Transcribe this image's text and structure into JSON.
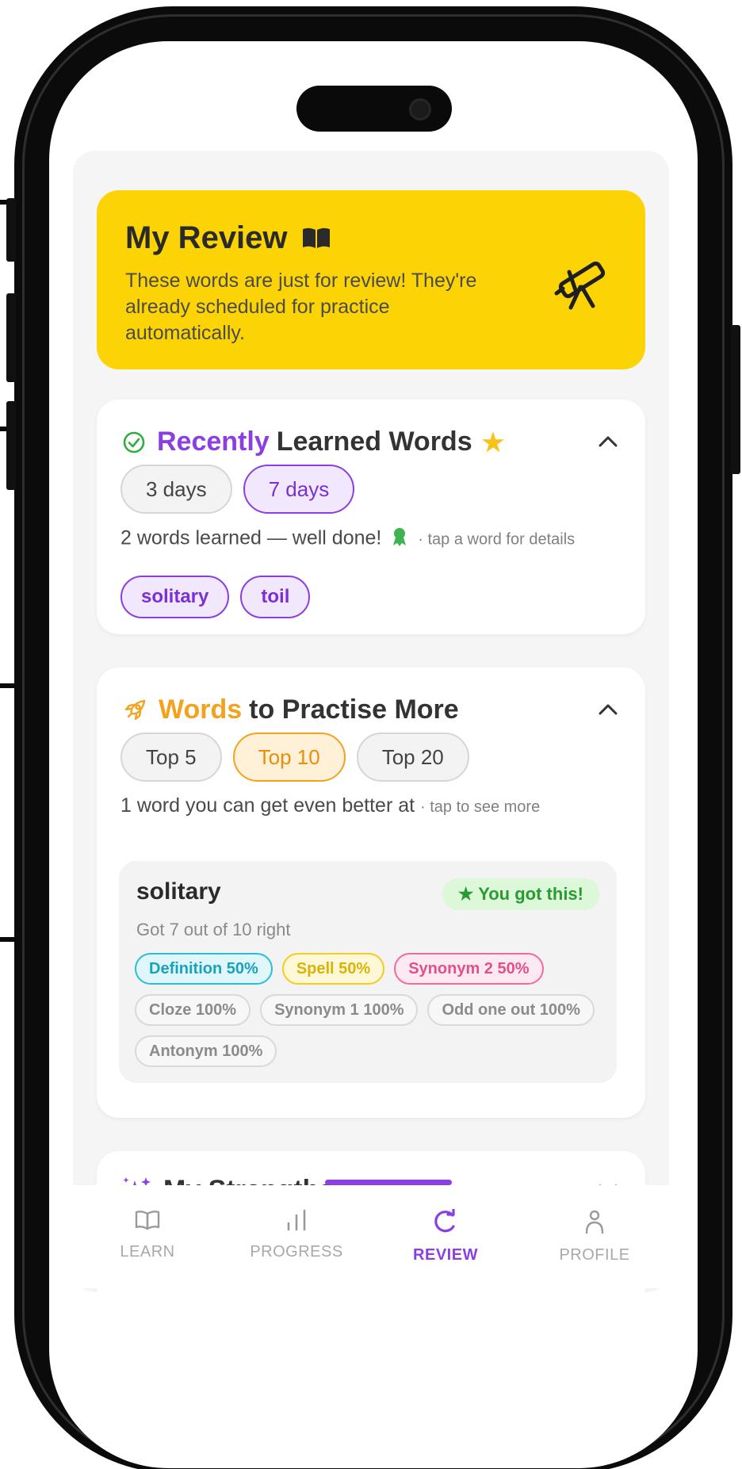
{
  "hero": {
    "title": "My Review",
    "description": "These words are just for review! They're already scheduled for practice automatically."
  },
  "recent": {
    "title_highlight": "Recently",
    "title_rest": "Learned Words",
    "filters": [
      "3 days",
      "7 days"
    ],
    "selected_filter": "7 days",
    "summary": "2 words learned — well done!",
    "hint": "· tap a word for details",
    "words": [
      "solitary",
      "toil"
    ]
  },
  "practise": {
    "title_highlight": "Words",
    "title_rest": "to Practise More",
    "filters": [
      "Top 5",
      "Top 10",
      "Top 20"
    ],
    "selected_filter": "Top 10",
    "summary": "1 word you can get even better at",
    "hint": "· tap to see more",
    "item": {
      "word": "solitary",
      "score": "Got 7 out of 10 right",
      "badge": "★ You got this!",
      "tags": [
        {
          "label": "Definition",
          "value": "50%",
          "style": "cyan"
        },
        {
          "label": "Spell",
          "value": "50%",
          "style": "yellow"
        },
        {
          "label": "Synonym 2",
          "value": "50%",
          "style": "pink"
        },
        {
          "label": "Cloze",
          "value": "100%",
          "style": "neutral"
        },
        {
          "label": "Synonym 1",
          "value": "100%",
          "style": "neutral"
        },
        {
          "label": "Odd one out",
          "value": "100%",
          "style": "neutral"
        },
        {
          "label": "Antonym",
          "value": "100%",
          "style": "neutral"
        }
      ]
    }
  },
  "strengths": {
    "title": "My Strengths"
  },
  "nav": {
    "active": "REVIEW",
    "items": [
      {
        "label": "LEARN",
        "icon": "book-icon"
      },
      {
        "label": "PROGRESS",
        "icon": "bar-chart-icon"
      },
      {
        "label": "REVIEW",
        "icon": "refresh-icon"
      },
      {
        "label": "PROFILE",
        "icon": "person-icon"
      }
    ]
  },
  "colors": {
    "accent_purple": "#8b3fe0",
    "accent_orange": "#f3a21e",
    "hero_yellow": "#fcd406",
    "success_green": "#2a9b33"
  }
}
